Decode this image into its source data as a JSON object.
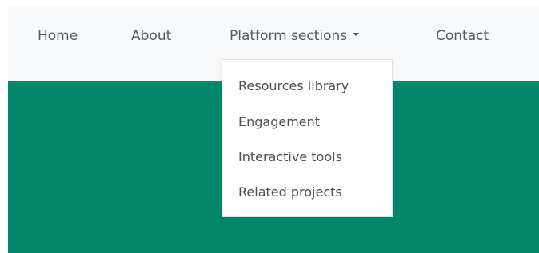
{
  "nav": {
    "home": "Home",
    "about": "About",
    "platform": "Platform sections",
    "contact": "Contact"
  },
  "dropdown": {
    "items": [
      "Resources library",
      "Engagement",
      "Interactive tools",
      "Related projects"
    ]
  },
  "colors": {
    "navbar_bg": "#f8f9fa",
    "hero_bg": "#00876a",
    "nav_text": "#555a60"
  },
  "icons": {
    "platform_caret": "caret-down-icon"
  }
}
